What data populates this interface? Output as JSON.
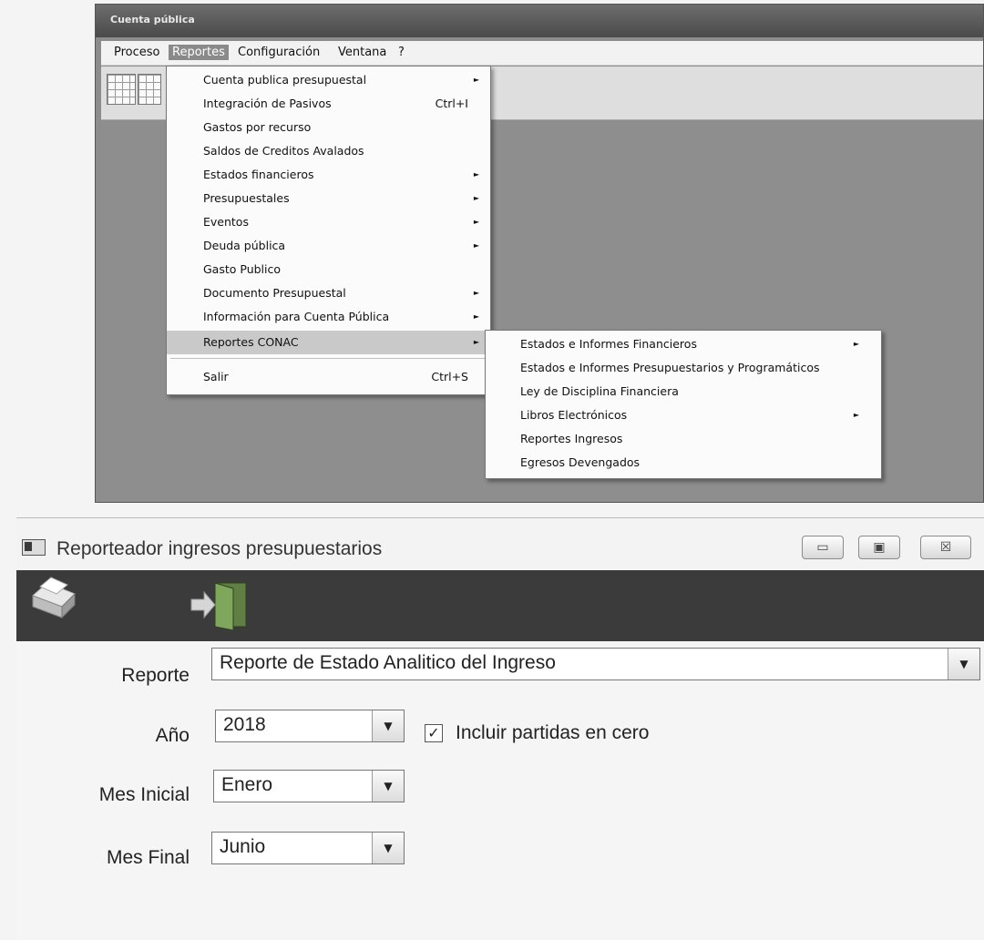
{
  "app": {
    "title": "Cuenta pública",
    "menu": [
      "Proceso",
      "Reportes",
      "Configuración",
      "Ventana",
      "?"
    ],
    "reportes_menu": [
      {
        "label": "Cuenta publica presupuestal",
        "shortcut": "",
        "submenu": true
      },
      {
        "label": "Integración de Pasivos",
        "shortcut": "Ctrl+I",
        "submenu": false
      },
      {
        "label": "Gastos por recurso",
        "shortcut": "",
        "submenu": false
      },
      {
        "label": "Saldos de Creditos Avalados",
        "shortcut": "",
        "submenu": false
      },
      {
        "label": "Estados financieros",
        "shortcut": "",
        "submenu": true
      },
      {
        "label": "Presupuestales",
        "shortcut": "",
        "submenu": true
      },
      {
        "label": "Eventos",
        "shortcut": "",
        "submenu": true
      },
      {
        "label": "Deuda pública",
        "shortcut": "",
        "submenu": true
      },
      {
        "label": "Gasto Publico",
        "shortcut": "",
        "submenu": false
      },
      {
        "label": "Documento Presupuestal",
        "shortcut": "",
        "submenu": true
      },
      {
        "label": "Información para Cuenta Pública",
        "shortcut": "",
        "submenu": true
      },
      {
        "label": "Reportes CONAC",
        "shortcut": "",
        "submenu": true
      },
      {
        "label": "Salir",
        "shortcut": "Ctrl+S",
        "submenu": false
      }
    ],
    "conac_submenu": [
      {
        "label": "Estados e Informes Financieros",
        "submenu": true
      },
      {
        "label": "Estados e Informes Presupuestarios y Programáticos",
        "submenu": false
      },
      {
        "label": "Ley de Disciplina Financiera",
        "submenu": false
      },
      {
        "label": "Libros Electrónicos",
        "submenu": true
      },
      {
        "label": "Reportes Ingresos",
        "submenu": false
      },
      {
        "label": "Egresos Devengados",
        "submenu": false
      }
    ],
    "arrow_glyph": "►"
  },
  "dialog": {
    "title": "Reporteador ingresos presupuestarios",
    "window_buttons": {
      "minimize": "▭",
      "maximize": "▣",
      "close": "☒"
    },
    "fields": {
      "reporte": {
        "label": "Reporte",
        "value": "Reporte de Estado Analitico del Ingreso"
      },
      "anio": {
        "label": "Año",
        "value": "2018"
      },
      "mes_inicial": {
        "label": "Mes Inicial",
        "value": "Enero"
      },
      "mes_final": {
        "label": "Mes Final",
        "value": "Junio"
      }
    },
    "checkbox": {
      "label": "Incluir partidas en cero",
      "checked": true,
      "mark": "✓"
    },
    "dropdown_glyph": "▼"
  }
}
